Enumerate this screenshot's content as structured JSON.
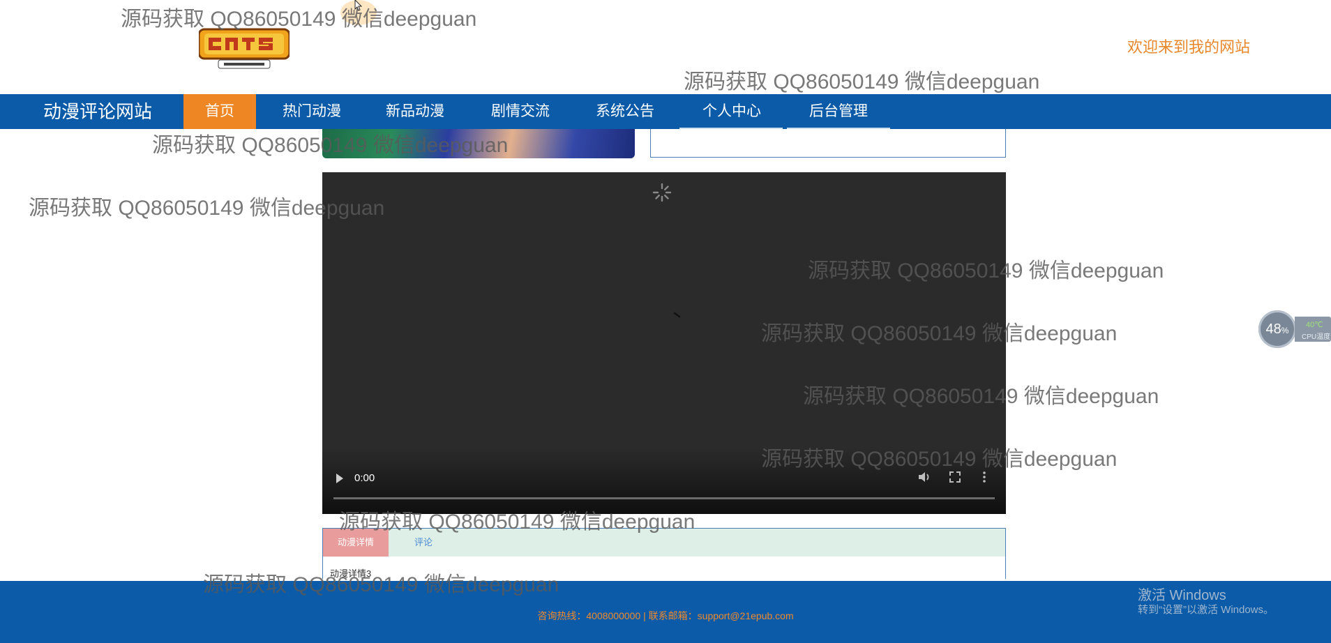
{
  "header": {
    "welcome_text": "欢迎来到我的网站"
  },
  "nav": {
    "site_name": "动漫评论网站",
    "items": [
      {
        "label": "首页"
      },
      {
        "label": "热门动漫"
      },
      {
        "label": "新品动漫"
      },
      {
        "label": "剧情交流"
      },
      {
        "label": "系统公告"
      },
      {
        "label": "个人中心"
      },
      {
        "label": "后台管理"
      }
    ],
    "active_index": 0
  },
  "video": {
    "current_time": "0:00"
  },
  "tabs": {
    "items": [
      {
        "label": "动漫详情"
      },
      {
        "label": "评论"
      }
    ],
    "active_index": 0,
    "content": "动漫详情3"
  },
  "footer": {
    "contact": "咨询热线：4008000000 | 联系邮箱：support@21epub.com"
  },
  "os_overlay": {
    "activate_title": "激活 Windows",
    "activate_sub": "转到“设置”以激活 Windows。",
    "cpu_percent": "48",
    "cpu_percent_unit": "%",
    "cpu_temp": "40℃",
    "cpu_label": "CPU温度"
  },
  "watermarks": [
    "源码获取 QQ86050149 微信deepguan",
    "源码获取 QQ86050149 微信deepguan",
    "源码获取 QQ86050149 微信deepguan",
    "源码获取 QQ86050149 微信deepguan",
    "源码获取 QQ86050149 微信deepguan",
    "源码获取 QQ86050149 微信deepguan",
    "源码获取 QQ86050149 微信deepguan",
    "源码获取 QQ86050149 微信deepguan",
    "源码获取 QQ86050149 微信deepguan",
    "源码获取 QQ86050149 微信deepguan"
  ],
  "colors": {
    "nav_bg": "#0b5ba8",
    "nav_active": "#ee8623",
    "accent_orange": "#e8872a",
    "tab_active": "#e89c9c",
    "tab_bar": "#ddefe6"
  }
}
